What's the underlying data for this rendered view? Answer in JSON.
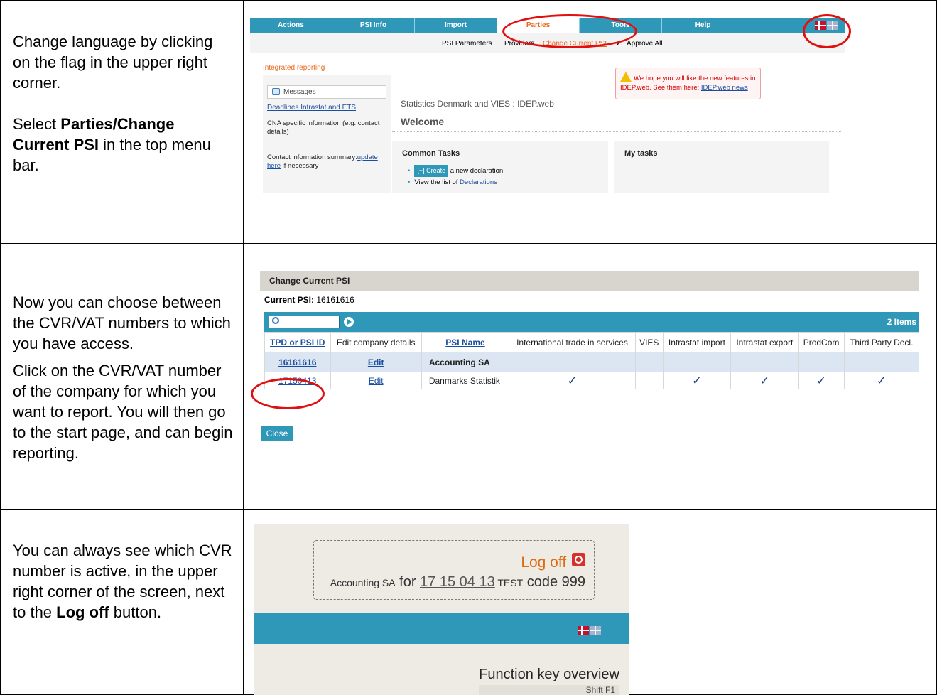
{
  "row1": {
    "para1": "Change language by clicking on the flag in the upper right corner.",
    "para2_pre": "Select ",
    "para2_bold": "Parties/Change Current PSI",
    "para2_post": " in the top menu bar."
  },
  "row2": {
    "para1": "Now you can choose between the CVR/VAT numbers to which you have access.",
    "para2": "Click on the CVR/VAT number of the company for which you want to report. You will then go to the start page, and can begin reporting."
  },
  "row3": {
    "para_pre": "You can always see which CVR number is active, in the upper right corner of the screen, next to the ",
    "para_bold": "Log off",
    "para_post": " button."
  },
  "screen1": {
    "tabs": [
      "Actions",
      "PSI Info",
      "Import",
      "Parties",
      "Tools",
      "Help"
    ],
    "subnav": [
      "PSI Parameters",
      "Providers",
      "Change Current PSI",
      "Approve All"
    ],
    "integrated": "Integrated reporting",
    "messages": "Messages",
    "deadlines": "Deadlines Intrastat and ETS",
    "cna": "CNA specific information (e.g. contact details)",
    "contact_pre": "Contact information summary:",
    "contact_link": "update here",
    "contact_post": " if necessary",
    "notice_text": "We hope you will like the new features in IDEP.web. See them here: ",
    "notice_link": "IDEP.web news",
    "stats": "Statistics Denmark and VIES : IDEP.web",
    "welcome": "Welcome",
    "common_tasks": "Common Tasks",
    "create_btn": "[+] Create",
    "create_rest": " a new declaration",
    "view_pre": "View the list of ",
    "view_link": "Declarations",
    "my_tasks": "My tasks"
  },
  "screen2": {
    "title": "Change Current PSI",
    "current_label": "Current PSI:",
    "current_value": " 16161616",
    "items": "2 Items",
    "columns": [
      "TPD or PSI ID",
      "Edit company details",
      "PSI Name",
      "International trade in services",
      "VIES",
      "Intrastat import",
      "Intrastat export",
      "ProdCom",
      "Third Party Decl."
    ],
    "rows": [
      {
        "id": "16161616",
        "edit": "Edit",
        "name": "Accounting SA"
      },
      {
        "id": "17150413",
        "edit": "Edit",
        "name": "Danmarks Statistik"
      }
    ],
    "close": "Close"
  },
  "screen3": {
    "logoff": "Log off",
    "company": "Accounting SA",
    "for": " for ",
    "cvr": "17 15 04 13",
    "test": " TEST",
    "code": " code 999",
    "fko": "Function key overview",
    "shift": "Shift F1"
  }
}
